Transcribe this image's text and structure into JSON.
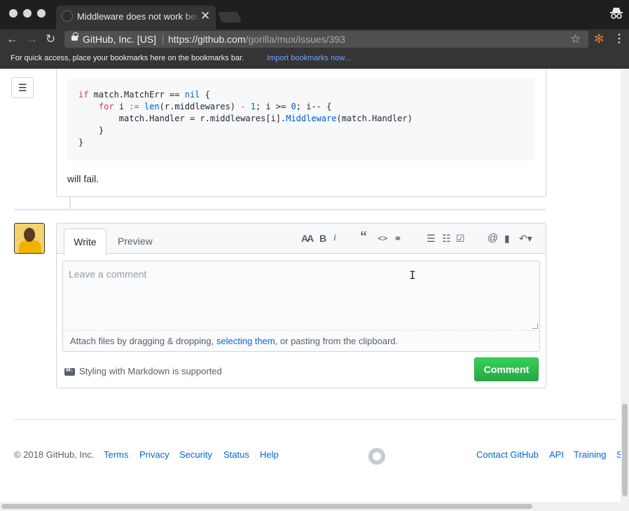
{
  "browser": {
    "tab_title": "Middleware does not work bec",
    "tab_close": "✕",
    "site_owner": "GitHub, Inc. [US]",
    "url_scheme_host": "https://github.com",
    "url_path": "/gorilla/mux/issues/393",
    "bookmarks_prompt": "For quick access, place your bookmarks here on the bookmarks bar.",
    "bookmarks_import": "Import bookmarks now..."
  },
  "comment": {
    "code_lines": [
      "if match.MatchErr == nil {",
      "    for i := len(r.middlewares) - 1; i >= 0; i-- {",
      "        match.Handler = r.middlewares[i].Middleware(match.Handler)",
      "    }",
      "}"
    ],
    "text": "will fail."
  },
  "form": {
    "tab_write": "Write",
    "tab_preview": "Preview",
    "placeholder": "Leave a comment",
    "attach_prefix": "Attach files by dragging & dropping, ",
    "attach_link": "selecting them",
    "attach_suffix": ", or pasting from the clipboard.",
    "markdown_badge": "M↓",
    "markdown_note": "Styling with Markdown is supported",
    "submit_label": "Comment",
    "toolbar_icons": [
      "text-size-icon",
      "bold-icon",
      "italic-icon",
      "quote-icon",
      "code-icon",
      "link-icon",
      "unordered-list-icon",
      "ordered-list-icon",
      "task-list-icon",
      "mention-icon",
      "bookmark-icon",
      "reply-icon"
    ]
  },
  "footer": {
    "copyright": "© 2018 GitHub, Inc.",
    "links_left": [
      "Terms",
      "Privacy",
      "Security",
      "Status",
      "Help"
    ],
    "links_right": [
      "Contact GitHub",
      "API",
      "Training",
      "S"
    ]
  },
  "colors": {
    "link": "#0366d6",
    "comment_button": "#28a745",
    "chrome_dark": "#353535"
  }
}
